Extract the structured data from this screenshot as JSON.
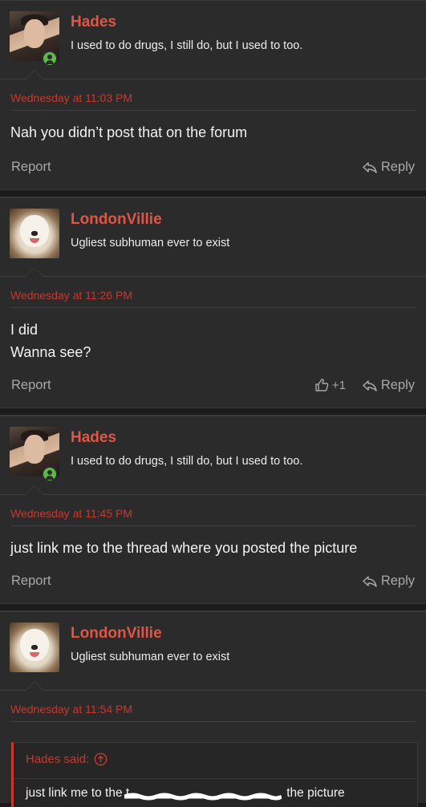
{
  "colors": {
    "accent": "#e25544",
    "date": "#c9382e",
    "online": "#5fb84a",
    "background": "#2b2b2b"
  },
  "posts": [
    {
      "username": "Hades",
      "user_title": "I used to do drugs, I still do, but I used to too.",
      "online": true,
      "avatar": "hades-avatar",
      "date": "Wednesday at 11:03 PM",
      "message": [
        "Nah you didn’t post that on the forum"
      ],
      "report": "Report",
      "reply": "Reply"
    },
    {
      "username": "LondonVillie",
      "user_title": "Ugliest subhuman ever to exist",
      "online": false,
      "avatar": "dog-avatar",
      "date": "Wednesday at 11:26 PM",
      "message": [
        "I did",
        "Wanna see?"
      ],
      "report": "Report",
      "reply": "Reply",
      "likes": "+1"
    },
    {
      "username": "Hades",
      "user_title": "I used to do drugs, I still do, but I used to too.",
      "online": true,
      "avatar": "hades-avatar",
      "date": "Wednesday at 11:45 PM",
      "message": [
        "just link me to the thread where you posted the picture"
      ],
      "report": "Report",
      "reply": "Reply"
    },
    {
      "username": "LondonVillie",
      "user_title": "Ugliest subhuman ever to exist",
      "online": false,
      "avatar": "dog-avatar",
      "date": "Wednesday at 11:54 PM",
      "quote": {
        "author": "Hades said:",
        "text_before": "just link me to the t",
        "text_after": "the picture"
      }
    }
  ]
}
